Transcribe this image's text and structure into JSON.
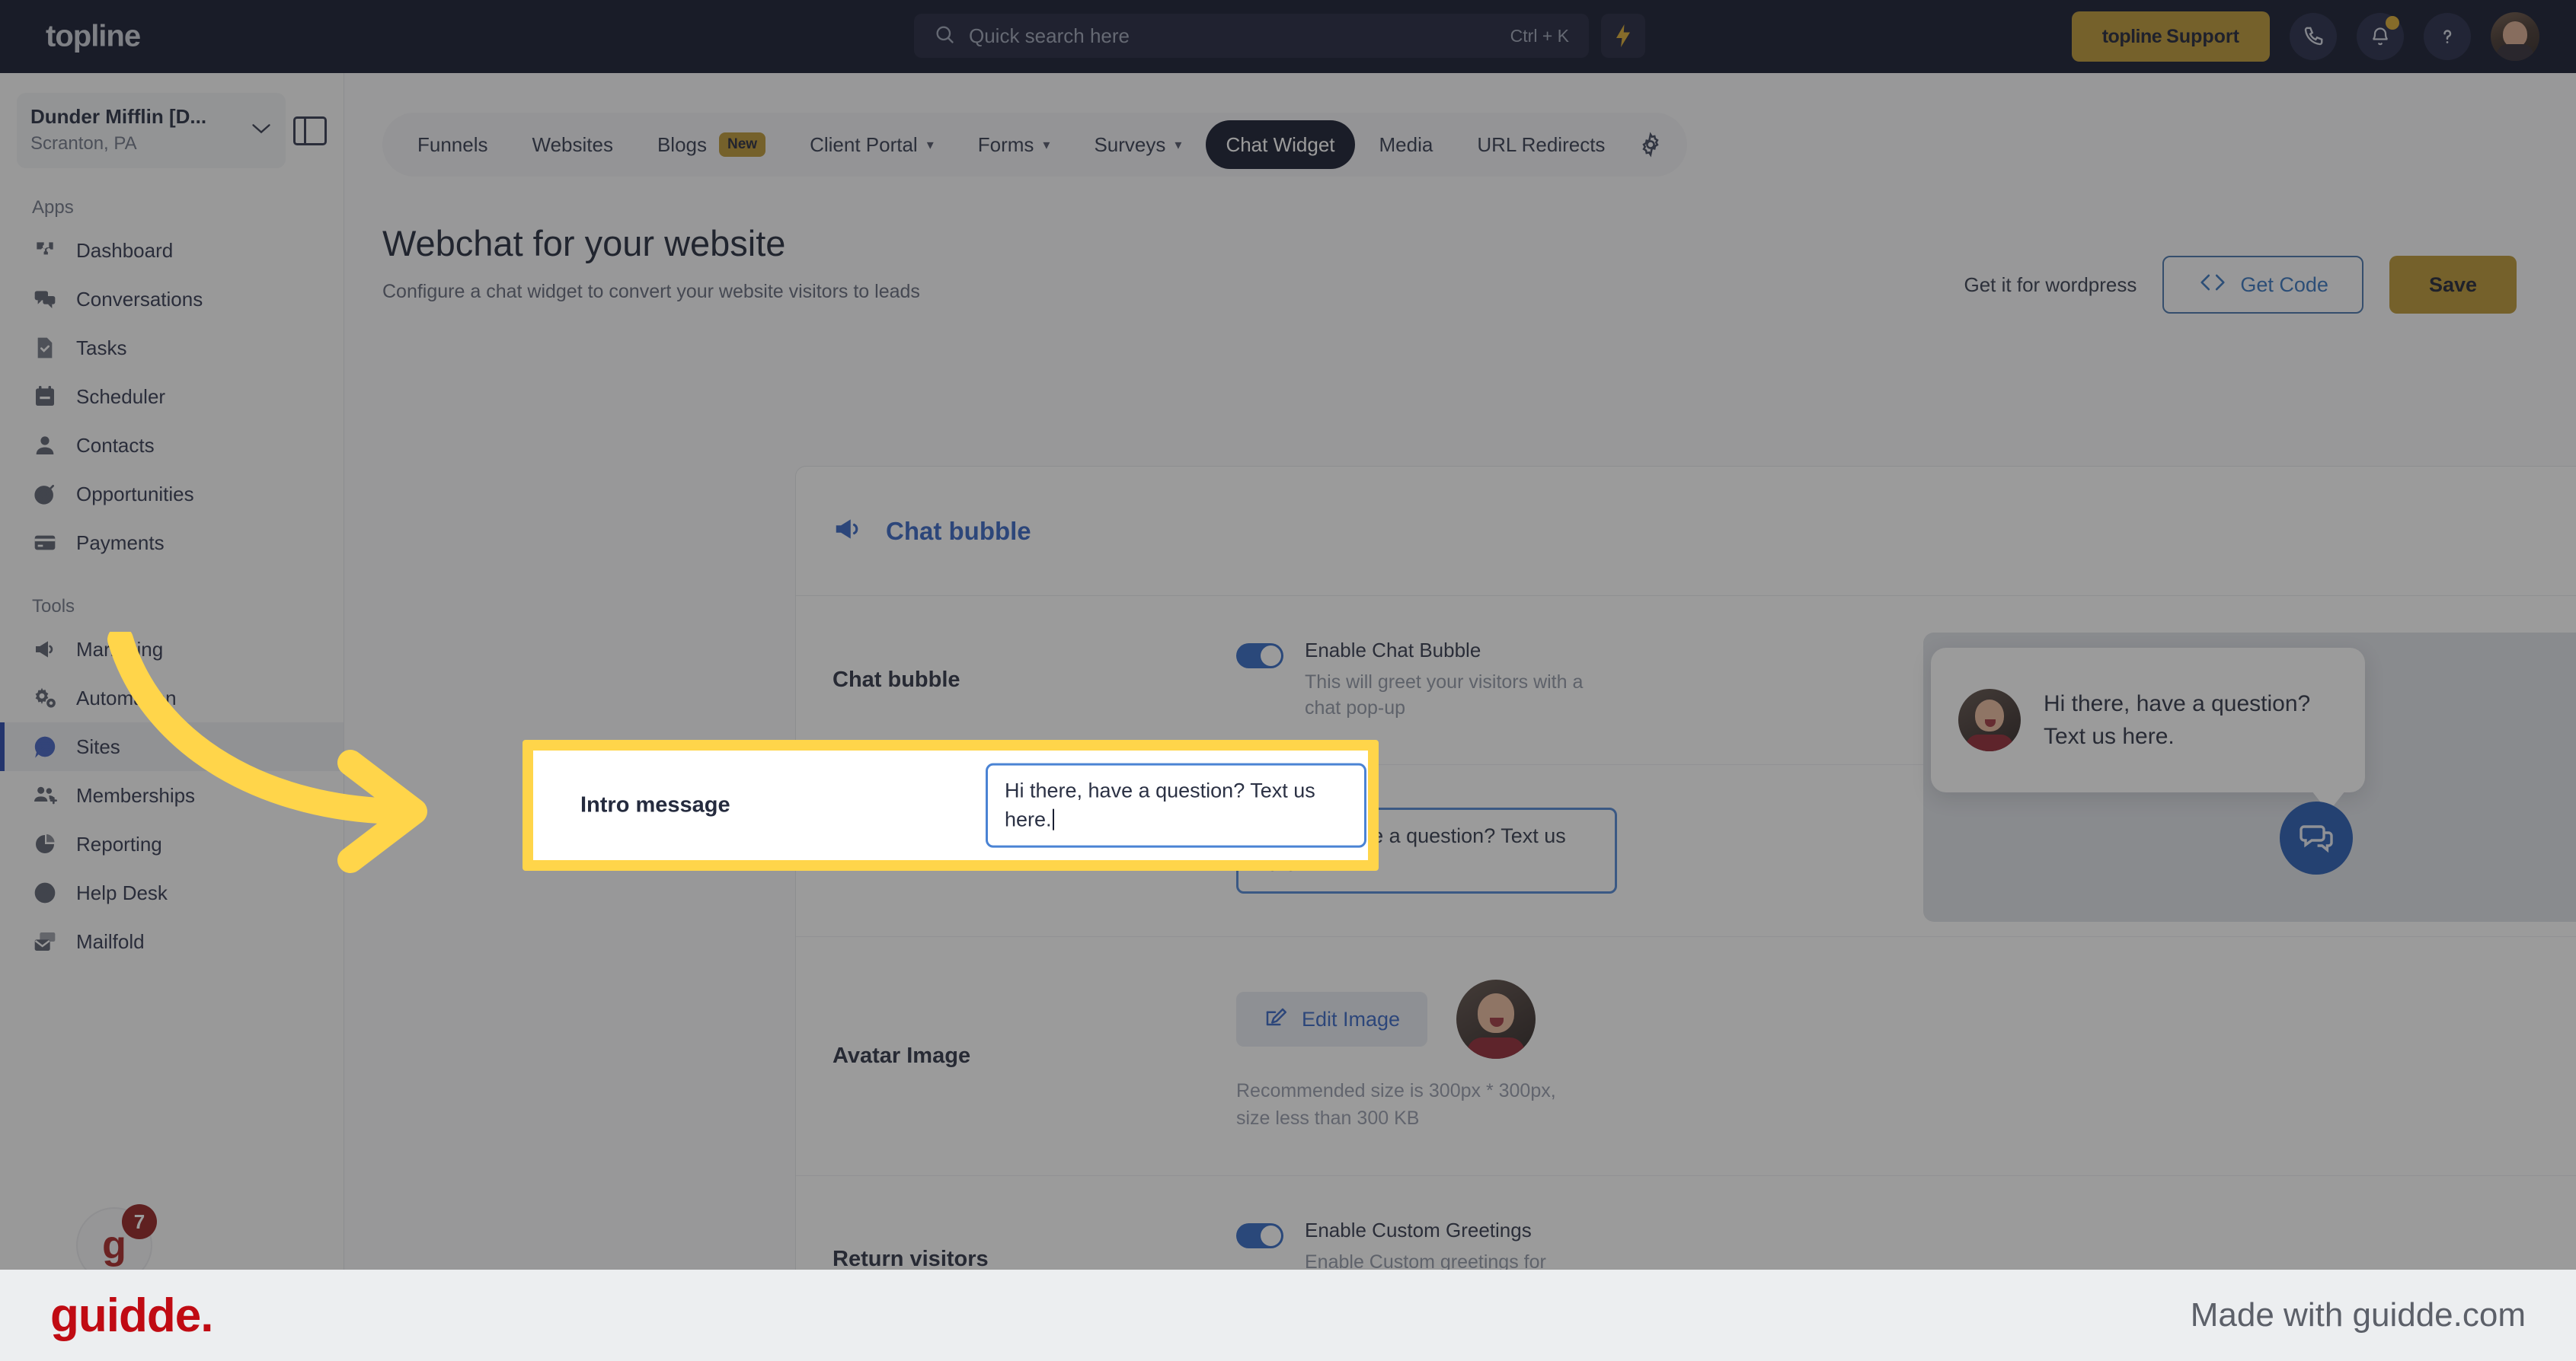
{
  "topbar": {
    "brand": "topline",
    "search": {
      "placeholder": "Quick search here",
      "shortcut": "Ctrl + K",
      "icon": "search-icon"
    },
    "bolt_icon": "lightning-bolt-icon",
    "support_button": {
      "logo": "topline",
      "label": " Support"
    },
    "phone_icon": "phone-icon",
    "bell_icon": "bell-icon",
    "help_icon": "question-mark-icon",
    "avatar": "user-avatar"
  },
  "sidebar": {
    "location": {
      "name": "Dunder Mifflin [D...",
      "sub": "Scranton, PA",
      "chevron": "chevron-down-icon"
    },
    "panel_toggle_icon": "sidebar-panel-icon",
    "sections": [
      {
        "label": "Apps",
        "items": [
          {
            "label": "Dashboard",
            "icon": "puzzle-icon",
            "active": false
          },
          {
            "label": "Conversations",
            "icon": "chat-bubbles-icon",
            "active": false
          },
          {
            "label": "Tasks",
            "icon": "task-check-icon",
            "active": false
          },
          {
            "label": "Scheduler",
            "icon": "calendar-icon",
            "active": false
          },
          {
            "label": "Contacts",
            "icon": "person-icon",
            "active": false
          },
          {
            "label": "Opportunities",
            "icon": "target-icon",
            "active": false
          },
          {
            "label": "Payments",
            "icon": "credit-card-icon",
            "active": false
          }
        ]
      },
      {
        "label": "Tools",
        "items": [
          {
            "label": "Marketing",
            "icon": "megaphone-icon",
            "active": false
          },
          {
            "label": "Automation",
            "icon": "gears-icon",
            "active": false
          },
          {
            "label": "Sites",
            "icon": "globe-rocket-icon",
            "active": true
          },
          {
            "label": "Memberships",
            "icon": "people-add-icon",
            "active": false
          },
          {
            "label": "Reporting",
            "icon": "pie-chart-icon",
            "active": false
          },
          {
            "label": "Help Desk",
            "icon": "help-circle-icon",
            "active": false
          },
          {
            "label": "Mailfold",
            "icon": "mail-stack-icon",
            "active": false
          }
        ]
      }
    ],
    "bottom_widget": {
      "label": "g",
      "badge": "7"
    }
  },
  "tabs": [
    {
      "label": "Funnels",
      "active": false,
      "caret": false,
      "badge": ""
    },
    {
      "label": "Websites",
      "active": false,
      "caret": false,
      "badge": ""
    },
    {
      "label": "Blogs",
      "active": false,
      "caret": false,
      "badge": "New"
    },
    {
      "label": "Client Portal",
      "active": false,
      "caret": true,
      "badge": ""
    },
    {
      "label": "Forms",
      "active": false,
      "caret": true,
      "badge": ""
    },
    {
      "label": "Surveys",
      "active": false,
      "caret": true,
      "badge": ""
    },
    {
      "label": "Chat Widget",
      "active": true,
      "caret": false,
      "badge": ""
    },
    {
      "label": "Media",
      "active": false,
      "caret": false,
      "badge": ""
    },
    {
      "label": "URL Redirects",
      "active": false,
      "caret": false,
      "badge": ""
    }
  ],
  "tabs_gear_icon": "gear-icon",
  "page": {
    "title": "Webchat for your website",
    "subtitle": "Configure a chat widget to convert your website visitors to leads",
    "wordpress_link": "Get it for wordpress",
    "get_code_label": "Get Code",
    "get_code_icon": "code-brackets-icon",
    "save_label": "Save"
  },
  "card": {
    "icon": "megaphone-icon",
    "title": "Chat bubble",
    "collapse_icon": "chevron-down-icon",
    "rows": {
      "chat_bubble": {
        "label": "Chat bubble",
        "toggle_on": true,
        "title": "Enable Chat Bubble",
        "desc": "This will greet your visitors with a chat pop-up"
      },
      "intro_message": {
        "label": "Intro message",
        "value": "Hi there, have a question? Text us here."
      },
      "avatar_image": {
        "label": "Avatar Image",
        "edit_button": "Edit Image",
        "edit_icon": "edit-pencil-icon",
        "hint": "Recommended size is 300px * 300px, size less than 300 KB"
      },
      "return_visitors": {
        "label": "Return visitors",
        "toggle_on": true,
        "title": "Enable Custom Greetings",
        "desc": "Enable Custom greetings for returning"
      }
    }
  },
  "preview": {
    "bubble_text": "Hi there, have a question? Text us here.",
    "launcher_icon": "chat-bubbles-icon",
    "avatar": "agent-avatar"
  },
  "footer": {
    "logo": "guidde.",
    "made_with": "Made with guidde.com"
  },
  "colors": {
    "topbar_bg": "#0b1026",
    "accent_gold": "#b8912c",
    "accent_blue": "#2f5fc0",
    "highlight_yellow": "#ffd54a",
    "guidde_red": "#c00b13",
    "active_nav": "#1f3fa8"
  }
}
